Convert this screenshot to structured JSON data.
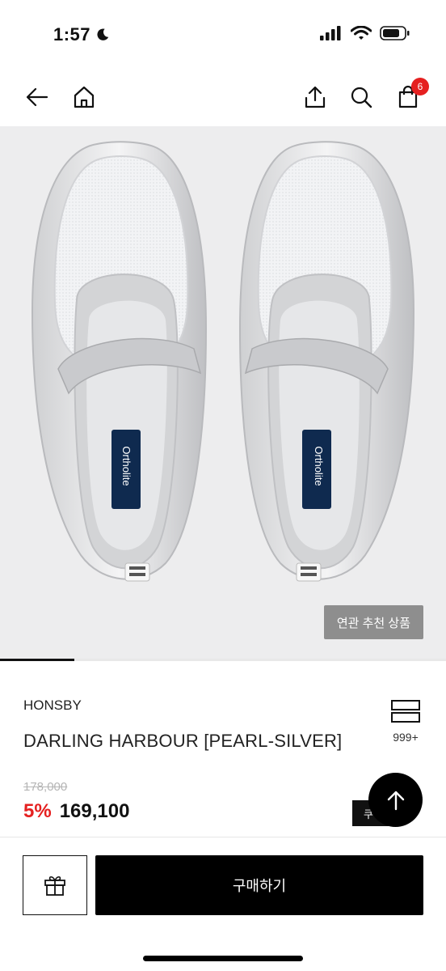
{
  "status_bar": {
    "time": "1:57",
    "icons": [
      "moon-icon",
      "cellular-signal-icon",
      "wifi-icon",
      "battery-icon"
    ]
  },
  "nav": {
    "icons": [
      "back-arrow-icon",
      "home-icon",
      "share-icon",
      "search-icon",
      "shopping-bag-icon"
    ],
    "cart_count": "6"
  },
  "product_image": {
    "insole_brand": "Ortholite",
    "related_button_label": "연관 추천 상품",
    "progress_fraction": 0.167
  },
  "product": {
    "brand": "HONSBY",
    "name": "DARLING HARBOUR [PEARL-SILVER]",
    "wishlist_count": "999+",
    "original_price": "178,000",
    "discount_rate": "5%",
    "sale_price": "169,100",
    "coupon_label": "쿠"
  },
  "bottom_bar": {
    "gift_icon": "gift-icon",
    "buy_label": "구매하기",
    "scroll_top_icon": "arrow-up-icon"
  },
  "colors": {
    "accent_red": "#e52020",
    "black": "#000000",
    "image_bg": "#ededee",
    "related_button_bg": "#8e8e8e"
  }
}
